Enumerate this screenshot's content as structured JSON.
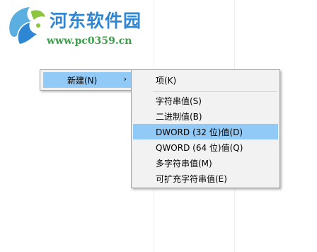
{
  "watermark": {
    "title": "河东软件园",
    "url": "www.pc0359.cn",
    "logo_icon": "leaf-e-logo-icon",
    "colors": {
      "title": "#2f86d3",
      "url": "#3aa14a"
    }
  },
  "context_menu": {
    "item_label": "新建(N)",
    "arrow_icon": "chevron-right-icon"
  },
  "submenu": {
    "items": [
      {
        "label": "项(K)"
      },
      {
        "label": "字符串值(S)"
      },
      {
        "label": "二进制值(B)"
      },
      {
        "label": "DWORD (32 位)值(D)",
        "highlighted": true
      },
      {
        "label": "QWORD (64 位)值(Q)"
      },
      {
        "label": "多字符串值(M)"
      },
      {
        "label": "可扩充字符串值(E)"
      }
    ]
  },
  "colors": {
    "highlight": "#91c9f7",
    "menu_background": "#f2f2f2",
    "menu_border": "#a0a0a0"
  }
}
